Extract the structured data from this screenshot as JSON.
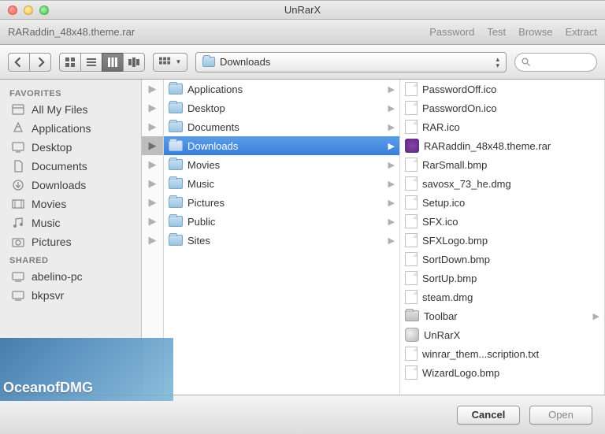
{
  "window": {
    "title": "UnRarX"
  },
  "maintoolbar": {
    "path": "RARaddin_48x48.theme.rar",
    "menu": {
      "password": "Password",
      "test": "Test",
      "browse": "Browse",
      "extract": "Extract"
    }
  },
  "controlbar": {
    "location_label": "Downloads",
    "search_placeholder": ""
  },
  "sidebar": {
    "favorites_header": "FAVORITES",
    "shared_header": "SHARED",
    "favorites": [
      {
        "label": "All My Files"
      },
      {
        "label": "Applications"
      },
      {
        "label": "Desktop"
      },
      {
        "label": "Documents"
      },
      {
        "label": "Downloads"
      },
      {
        "label": "Movies"
      },
      {
        "label": "Music"
      },
      {
        "label": "Pictures"
      }
    ],
    "shared": [
      {
        "label": "abelino-pc"
      },
      {
        "label": "bkpsvr"
      }
    ]
  },
  "columns": {
    "folders": [
      {
        "label": "Applications"
      },
      {
        "label": "Desktop"
      },
      {
        "label": "Documents"
      },
      {
        "label": "Downloads",
        "selected": true
      },
      {
        "label": "Movies"
      },
      {
        "label": "Music"
      },
      {
        "label": "Pictures"
      },
      {
        "label": "Public"
      },
      {
        "label": "Sites"
      }
    ],
    "files": [
      {
        "label": "PasswordOff.ico",
        "type": "file"
      },
      {
        "label": "PasswordOn.ico",
        "type": "file"
      },
      {
        "label": "RAR.ico",
        "type": "file"
      },
      {
        "label": "RARaddin_48x48.theme.rar",
        "type": "rar"
      },
      {
        "label": "RarSmall.bmp",
        "type": "file"
      },
      {
        "label": "savosx_73_he.dmg",
        "type": "file"
      },
      {
        "label": "Setup.ico",
        "type": "file"
      },
      {
        "label": "SFX.ico",
        "type": "file"
      },
      {
        "label": "SFXLogo.bmp",
        "type": "file"
      },
      {
        "label": "SortDown.bmp",
        "type": "file"
      },
      {
        "label": "SortUp.bmp",
        "type": "file"
      },
      {
        "label": "steam.dmg",
        "type": "file"
      },
      {
        "label": "Toolbar",
        "type": "folder"
      },
      {
        "label": "UnRarX",
        "type": "app"
      },
      {
        "label": "winrar_them...scription.txt",
        "type": "file"
      },
      {
        "label": "WizardLogo.bmp",
        "type": "file"
      }
    ]
  },
  "footer": {
    "cancel": "Cancel",
    "open": "Open"
  },
  "watermark": {
    "text": "OceanofDMG"
  }
}
